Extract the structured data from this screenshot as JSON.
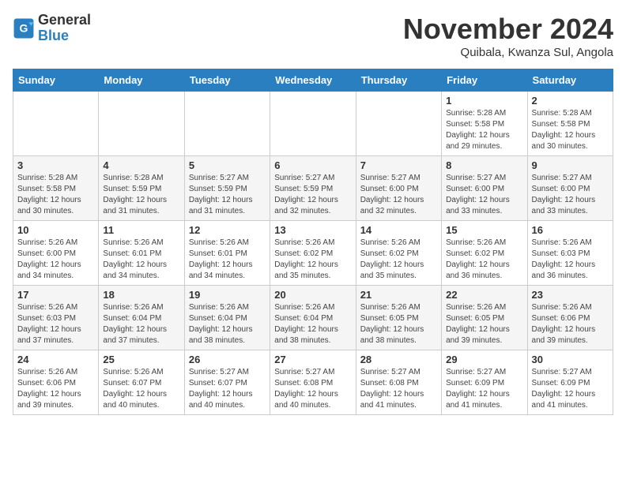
{
  "header": {
    "logo_line1": "General",
    "logo_line2": "Blue",
    "month_year": "November 2024",
    "location": "Quibala, Kwanza Sul, Angola"
  },
  "weekdays": [
    "Sunday",
    "Monday",
    "Tuesday",
    "Wednesday",
    "Thursday",
    "Friday",
    "Saturday"
  ],
  "weeks": [
    [
      {
        "day": "",
        "info": ""
      },
      {
        "day": "",
        "info": ""
      },
      {
        "day": "",
        "info": ""
      },
      {
        "day": "",
        "info": ""
      },
      {
        "day": "",
        "info": ""
      },
      {
        "day": "1",
        "info": "Sunrise: 5:28 AM\nSunset: 5:58 PM\nDaylight: 12 hours and 29 minutes."
      },
      {
        "day": "2",
        "info": "Sunrise: 5:28 AM\nSunset: 5:58 PM\nDaylight: 12 hours and 30 minutes."
      }
    ],
    [
      {
        "day": "3",
        "info": "Sunrise: 5:28 AM\nSunset: 5:58 PM\nDaylight: 12 hours and 30 minutes."
      },
      {
        "day": "4",
        "info": "Sunrise: 5:28 AM\nSunset: 5:59 PM\nDaylight: 12 hours and 31 minutes."
      },
      {
        "day": "5",
        "info": "Sunrise: 5:27 AM\nSunset: 5:59 PM\nDaylight: 12 hours and 31 minutes."
      },
      {
        "day": "6",
        "info": "Sunrise: 5:27 AM\nSunset: 5:59 PM\nDaylight: 12 hours and 32 minutes."
      },
      {
        "day": "7",
        "info": "Sunrise: 5:27 AM\nSunset: 6:00 PM\nDaylight: 12 hours and 32 minutes."
      },
      {
        "day": "8",
        "info": "Sunrise: 5:27 AM\nSunset: 6:00 PM\nDaylight: 12 hours and 33 minutes."
      },
      {
        "day": "9",
        "info": "Sunrise: 5:27 AM\nSunset: 6:00 PM\nDaylight: 12 hours and 33 minutes."
      }
    ],
    [
      {
        "day": "10",
        "info": "Sunrise: 5:26 AM\nSunset: 6:00 PM\nDaylight: 12 hours and 34 minutes."
      },
      {
        "day": "11",
        "info": "Sunrise: 5:26 AM\nSunset: 6:01 PM\nDaylight: 12 hours and 34 minutes."
      },
      {
        "day": "12",
        "info": "Sunrise: 5:26 AM\nSunset: 6:01 PM\nDaylight: 12 hours and 34 minutes."
      },
      {
        "day": "13",
        "info": "Sunrise: 5:26 AM\nSunset: 6:02 PM\nDaylight: 12 hours and 35 minutes."
      },
      {
        "day": "14",
        "info": "Sunrise: 5:26 AM\nSunset: 6:02 PM\nDaylight: 12 hours and 35 minutes."
      },
      {
        "day": "15",
        "info": "Sunrise: 5:26 AM\nSunset: 6:02 PM\nDaylight: 12 hours and 36 minutes."
      },
      {
        "day": "16",
        "info": "Sunrise: 5:26 AM\nSunset: 6:03 PM\nDaylight: 12 hours and 36 minutes."
      }
    ],
    [
      {
        "day": "17",
        "info": "Sunrise: 5:26 AM\nSunset: 6:03 PM\nDaylight: 12 hours and 37 minutes."
      },
      {
        "day": "18",
        "info": "Sunrise: 5:26 AM\nSunset: 6:04 PM\nDaylight: 12 hours and 37 minutes."
      },
      {
        "day": "19",
        "info": "Sunrise: 5:26 AM\nSunset: 6:04 PM\nDaylight: 12 hours and 38 minutes."
      },
      {
        "day": "20",
        "info": "Sunrise: 5:26 AM\nSunset: 6:04 PM\nDaylight: 12 hours and 38 minutes."
      },
      {
        "day": "21",
        "info": "Sunrise: 5:26 AM\nSunset: 6:05 PM\nDaylight: 12 hours and 38 minutes."
      },
      {
        "day": "22",
        "info": "Sunrise: 5:26 AM\nSunset: 6:05 PM\nDaylight: 12 hours and 39 minutes."
      },
      {
        "day": "23",
        "info": "Sunrise: 5:26 AM\nSunset: 6:06 PM\nDaylight: 12 hours and 39 minutes."
      }
    ],
    [
      {
        "day": "24",
        "info": "Sunrise: 5:26 AM\nSunset: 6:06 PM\nDaylight: 12 hours and 39 minutes."
      },
      {
        "day": "25",
        "info": "Sunrise: 5:26 AM\nSunset: 6:07 PM\nDaylight: 12 hours and 40 minutes."
      },
      {
        "day": "26",
        "info": "Sunrise: 5:27 AM\nSunset: 6:07 PM\nDaylight: 12 hours and 40 minutes."
      },
      {
        "day": "27",
        "info": "Sunrise: 5:27 AM\nSunset: 6:08 PM\nDaylight: 12 hours and 40 minutes."
      },
      {
        "day": "28",
        "info": "Sunrise: 5:27 AM\nSunset: 6:08 PM\nDaylight: 12 hours and 41 minutes."
      },
      {
        "day": "29",
        "info": "Sunrise: 5:27 AM\nSunset: 6:09 PM\nDaylight: 12 hours and 41 minutes."
      },
      {
        "day": "30",
        "info": "Sunrise: 5:27 AM\nSunset: 6:09 PM\nDaylight: 12 hours and 41 minutes."
      }
    ]
  ]
}
